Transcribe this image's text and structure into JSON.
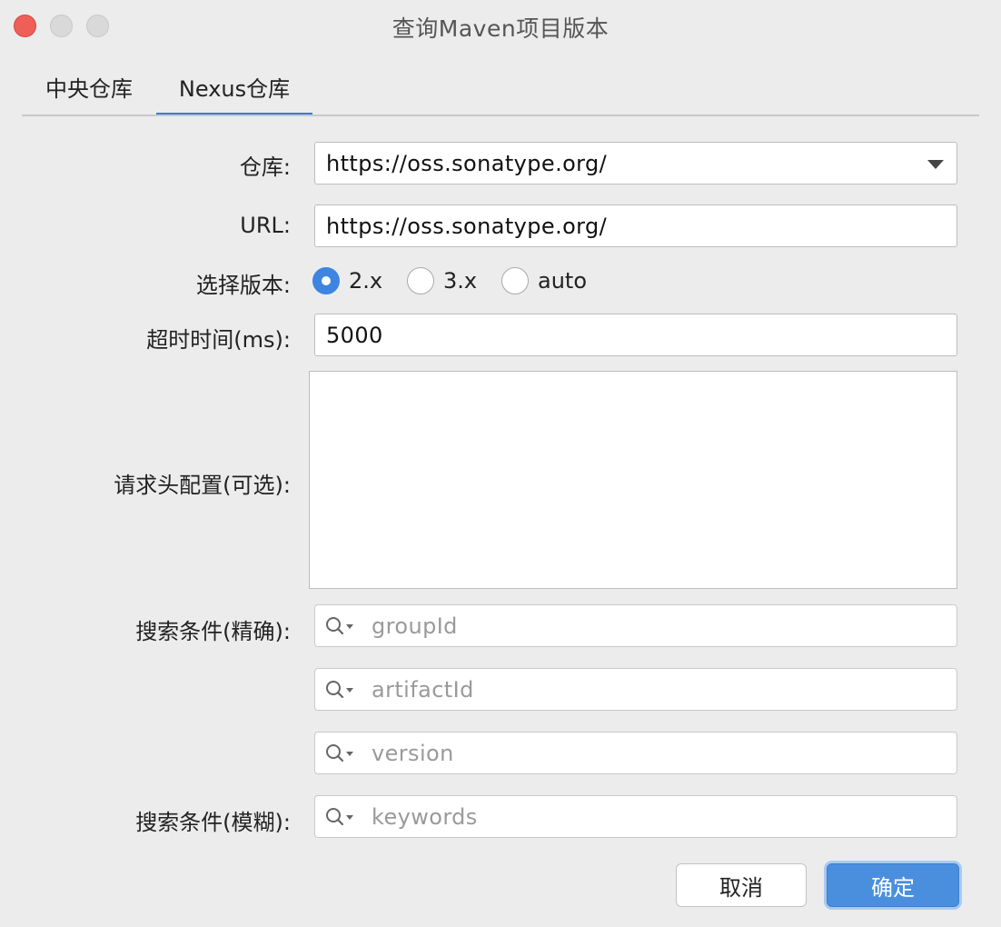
{
  "window": {
    "title": "查询Maven项目版本"
  },
  "tabs": [
    {
      "label": "中央仓库",
      "active": false
    },
    {
      "label": "Nexus仓库",
      "active": true
    }
  ],
  "form": {
    "repo_label": "仓库:",
    "repo_value": "https://oss.sonatype.org/",
    "url_label": "URL:",
    "url_value": "https://oss.sonatype.org/",
    "version_label": "选择版本:",
    "version_options": [
      {
        "label": "2.x",
        "checked": true
      },
      {
        "label": "3.x",
        "checked": false
      },
      {
        "label": "auto",
        "checked": false
      }
    ],
    "timeout_label": "超时时间(ms):",
    "timeout_value": "5000",
    "headers_label": "请求头配置(可选):",
    "headers_value": "",
    "exact_label": "搜索条件(精确):",
    "group_placeholder": "groupId",
    "artifact_placeholder": "artifactId",
    "version_placeholder": "version",
    "fuzzy_label": "搜索条件(模糊):",
    "keywords_placeholder": "keywords"
  },
  "buttons": {
    "cancel": "取消",
    "ok": "确定"
  },
  "colors": {
    "accent": "#3a7bd5",
    "primary_button": "#4a8fde",
    "close": "#ee5f58"
  },
  "icons": {
    "close": "close-icon",
    "minimize": "minimize-icon",
    "maximize": "maximize-icon",
    "search": "search-icon",
    "dropdown": "chevron-down-icon"
  }
}
